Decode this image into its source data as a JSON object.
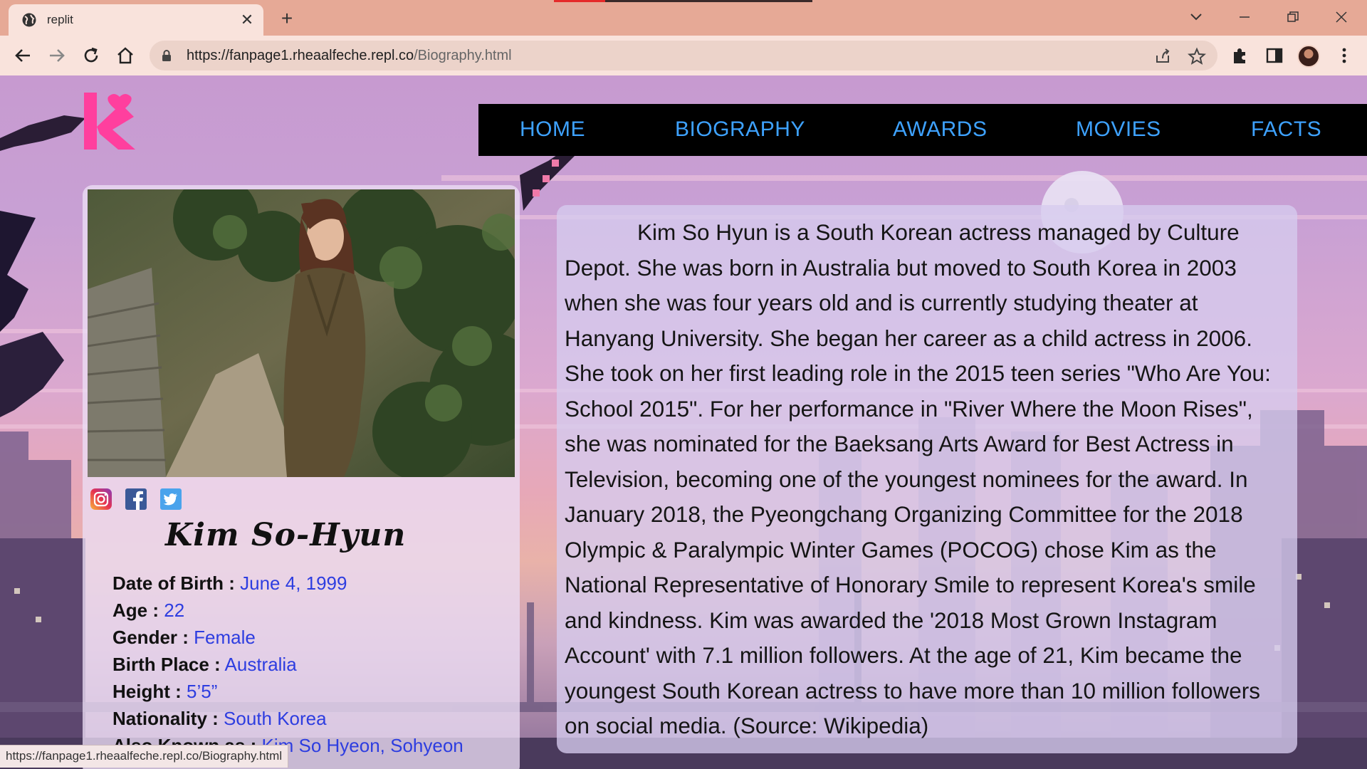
{
  "browser": {
    "tab_title": "replit",
    "url_host": "https://fanpage1.rheaalfeche.repl.co",
    "url_path": "/Biography.html",
    "status_url": "https://fanpage1.rheaalfeche.repl.co/Biography.html"
  },
  "nav": {
    "items": [
      "HOME",
      "BIOGRAPHY",
      "AWARDS",
      "MOVIES",
      "FACTS"
    ]
  },
  "profile": {
    "name": "Kim So-Hyun",
    "details": [
      {
        "label": "Date of Birth :",
        "value": "June 4, 1999"
      },
      {
        "label": "Age :",
        "value": "22"
      },
      {
        "label": "Gender :",
        "value": "Female"
      },
      {
        "label": "Birth Place :",
        "value": "Australia"
      },
      {
        "label": "Height :",
        "value": "5’5”"
      },
      {
        "label": "Nationality :",
        "value": "South Korea"
      },
      {
        "label": "Also Known as :",
        "value": "Kim So Hyeon, Sohyeon"
      }
    ],
    "social": [
      "instagram-icon",
      "facebook-icon",
      "twitter-icon"
    ]
  },
  "bio": {
    "text": "Kim So Hyun is a South Korean actress managed by Culture Depot. She was born in Australia but moved to South Korea in 2003 when she was four years old and is currently studying theater at Hanyang University. She began her career as a child actress in 2006. She took on her first leading role in the 2015 teen series \"Who Are You: School 2015\". For her performance in \"River Where the Moon Rises\", she was nominated for the Baeksang Arts Award for Best Actress in Television, becoming one of the youngest nominees for the award. In January 2018, the Pyeongchang Organizing Committee for the 2018 Olympic & Paralympic Winter Games (POCOG) chose Kim as the National Representative of Honorary Smile to represent Korea's smile and kindness. Kim was awarded the '2018 Most Grown Instagram Account' with 7.1 million followers. At the age of 21, Kim became the youngest South Korean actress to have more than 10 million followers on social media. (Source: Wikipedia)"
  },
  "colors": {
    "nav_link": "#3ea2ff",
    "detail_value": "#2d3de0",
    "logo": "#ff3f9e",
    "navbar_bg": "#000000"
  }
}
